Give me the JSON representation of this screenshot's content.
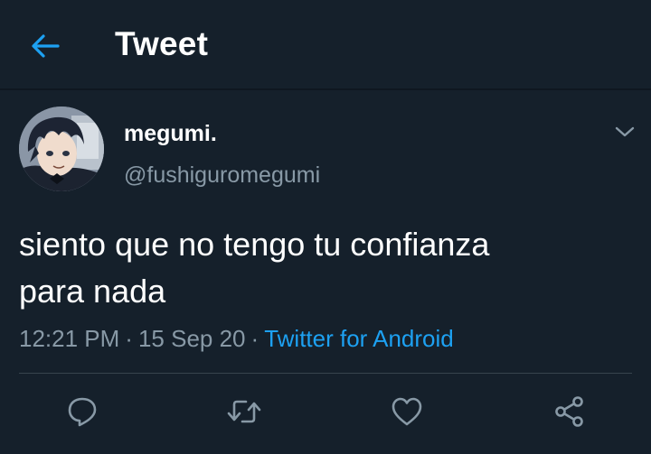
{
  "header": {
    "title": "Tweet",
    "back_icon": "arrow-left-icon"
  },
  "tweet": {
    "author": {
      "display_name": "megumi.",
      "handle": "@fushiguromegumi",
      "avatar_icon": "avatar"
    },
    "text": "siento que no tengo tu confianza\npara nada",
    "time": "12:21 PM",
    "date": "15 Sep 20",
    "separator": "·",
    "source": "Twitter for Android",
    "more_icon": "chevron-down-icon"
  },
  "actions": {
    "reply_icon": "reply-icon",
    "retweet_icon": "retweet-icon",
    "like_icon": "heart-icon",
    "share_icon": "share-icon"
  },
  "colors": {
    "background": "#15202b",
    "accent": "#1da1f2",
    "secondary_text": "#8899a6",
    "divider": "#38444d"
  }
}
